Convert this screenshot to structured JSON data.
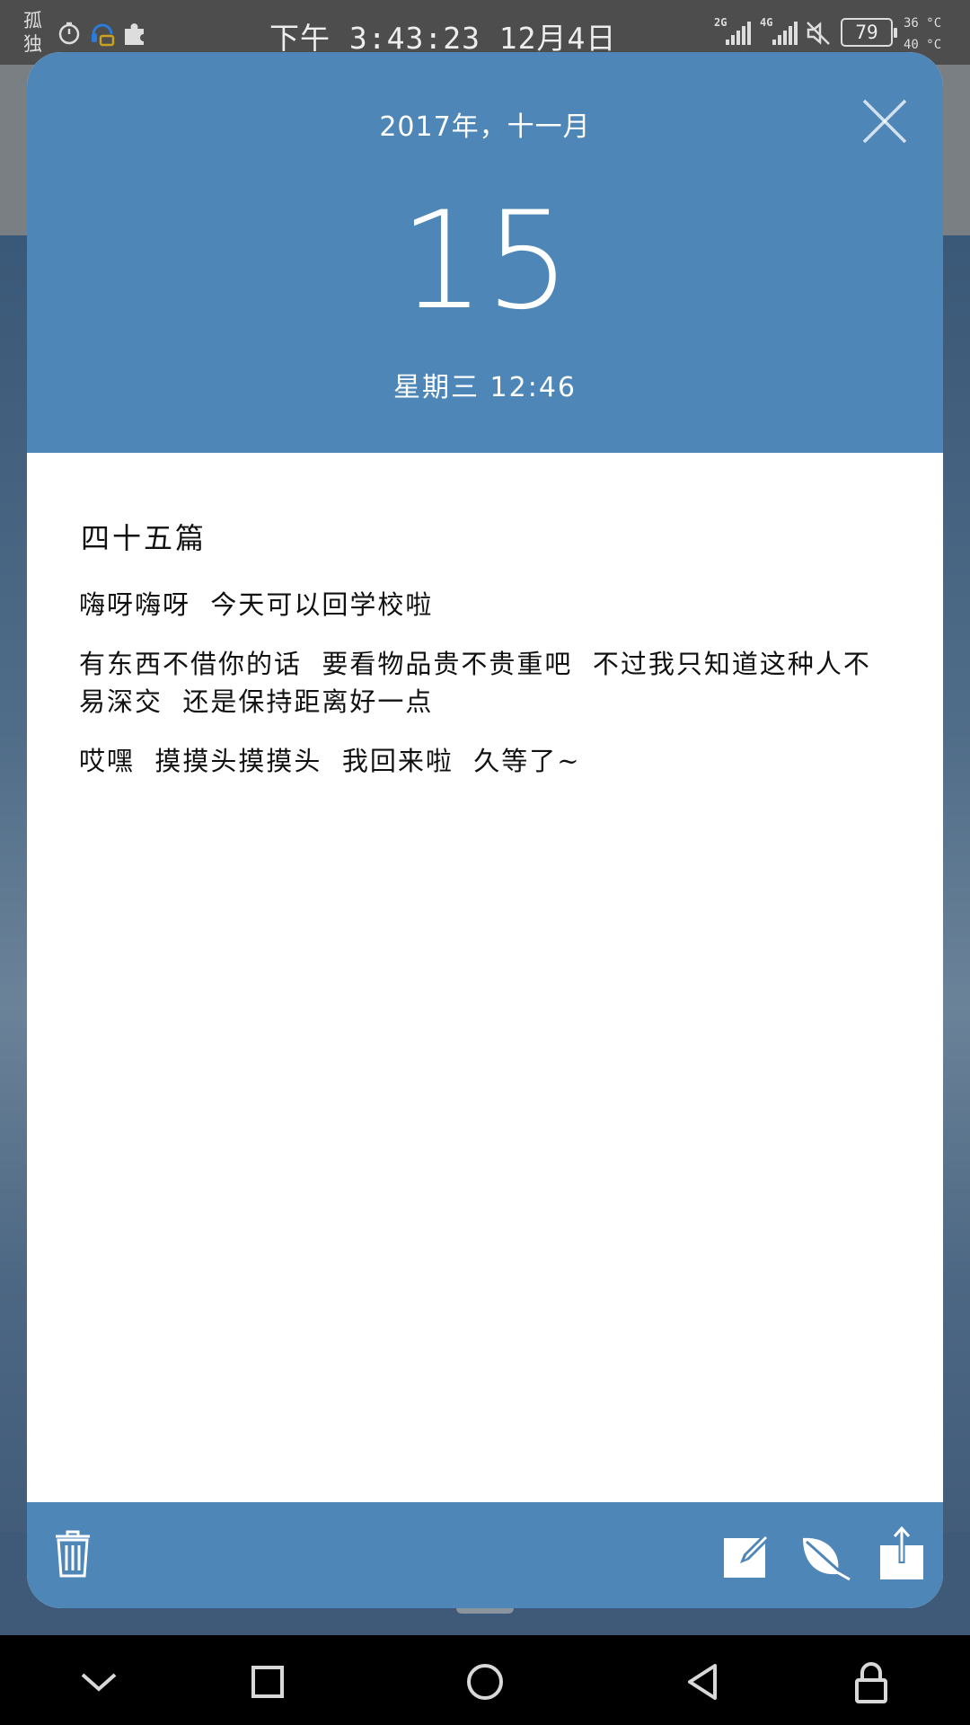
{
  "status_bar": {
    "carrier_label": "孤独",
    "time": "下午 3:43:23 12月4日",
    "network_primary": "2G",
    "network_secondary": "4G",
    "battery_level": "79",
    "temp_top": "36 °C",
    "temp_bottom": "40 °C",
    "icons": [
      "timer-icon",
      "headset-icon",
      "puzzle-icon",
      "signal-icon",
      "mute-icon",
      "battery-icon"
    ]
  },
  "dialog": {
    "header": {
      "year_month": "2017年，十一月",
      "day": "15",
      "weekday_time": "星期三 12:46",
      "background_color": "#4e87b7"
    },
    "entry": {
      "title": "四十五篇",
      "paragraphs": [
        "嗨呀嗨呀  今天可以回学校啦",
        "有东西不借你的话  要看物品贵不贵重吧  不过我只知道这种人不易深交  还是保持距离好一点",
        "哎嘿  摸摸头摸摸头  我回来啦  久等了~"
      ]
    },
    "footer_actions": [
      "delete-icon",
      "edit-icon",
      "leaf-icon",
      "share-icon"
    ]
  },
  "navigation_bar": {
    "buttons": [
      "chevron-down-icon",
      "recent-apps-icon",
      "home-icon",
      "back-icon",
      "lock-icon"
    ]
  }
}
